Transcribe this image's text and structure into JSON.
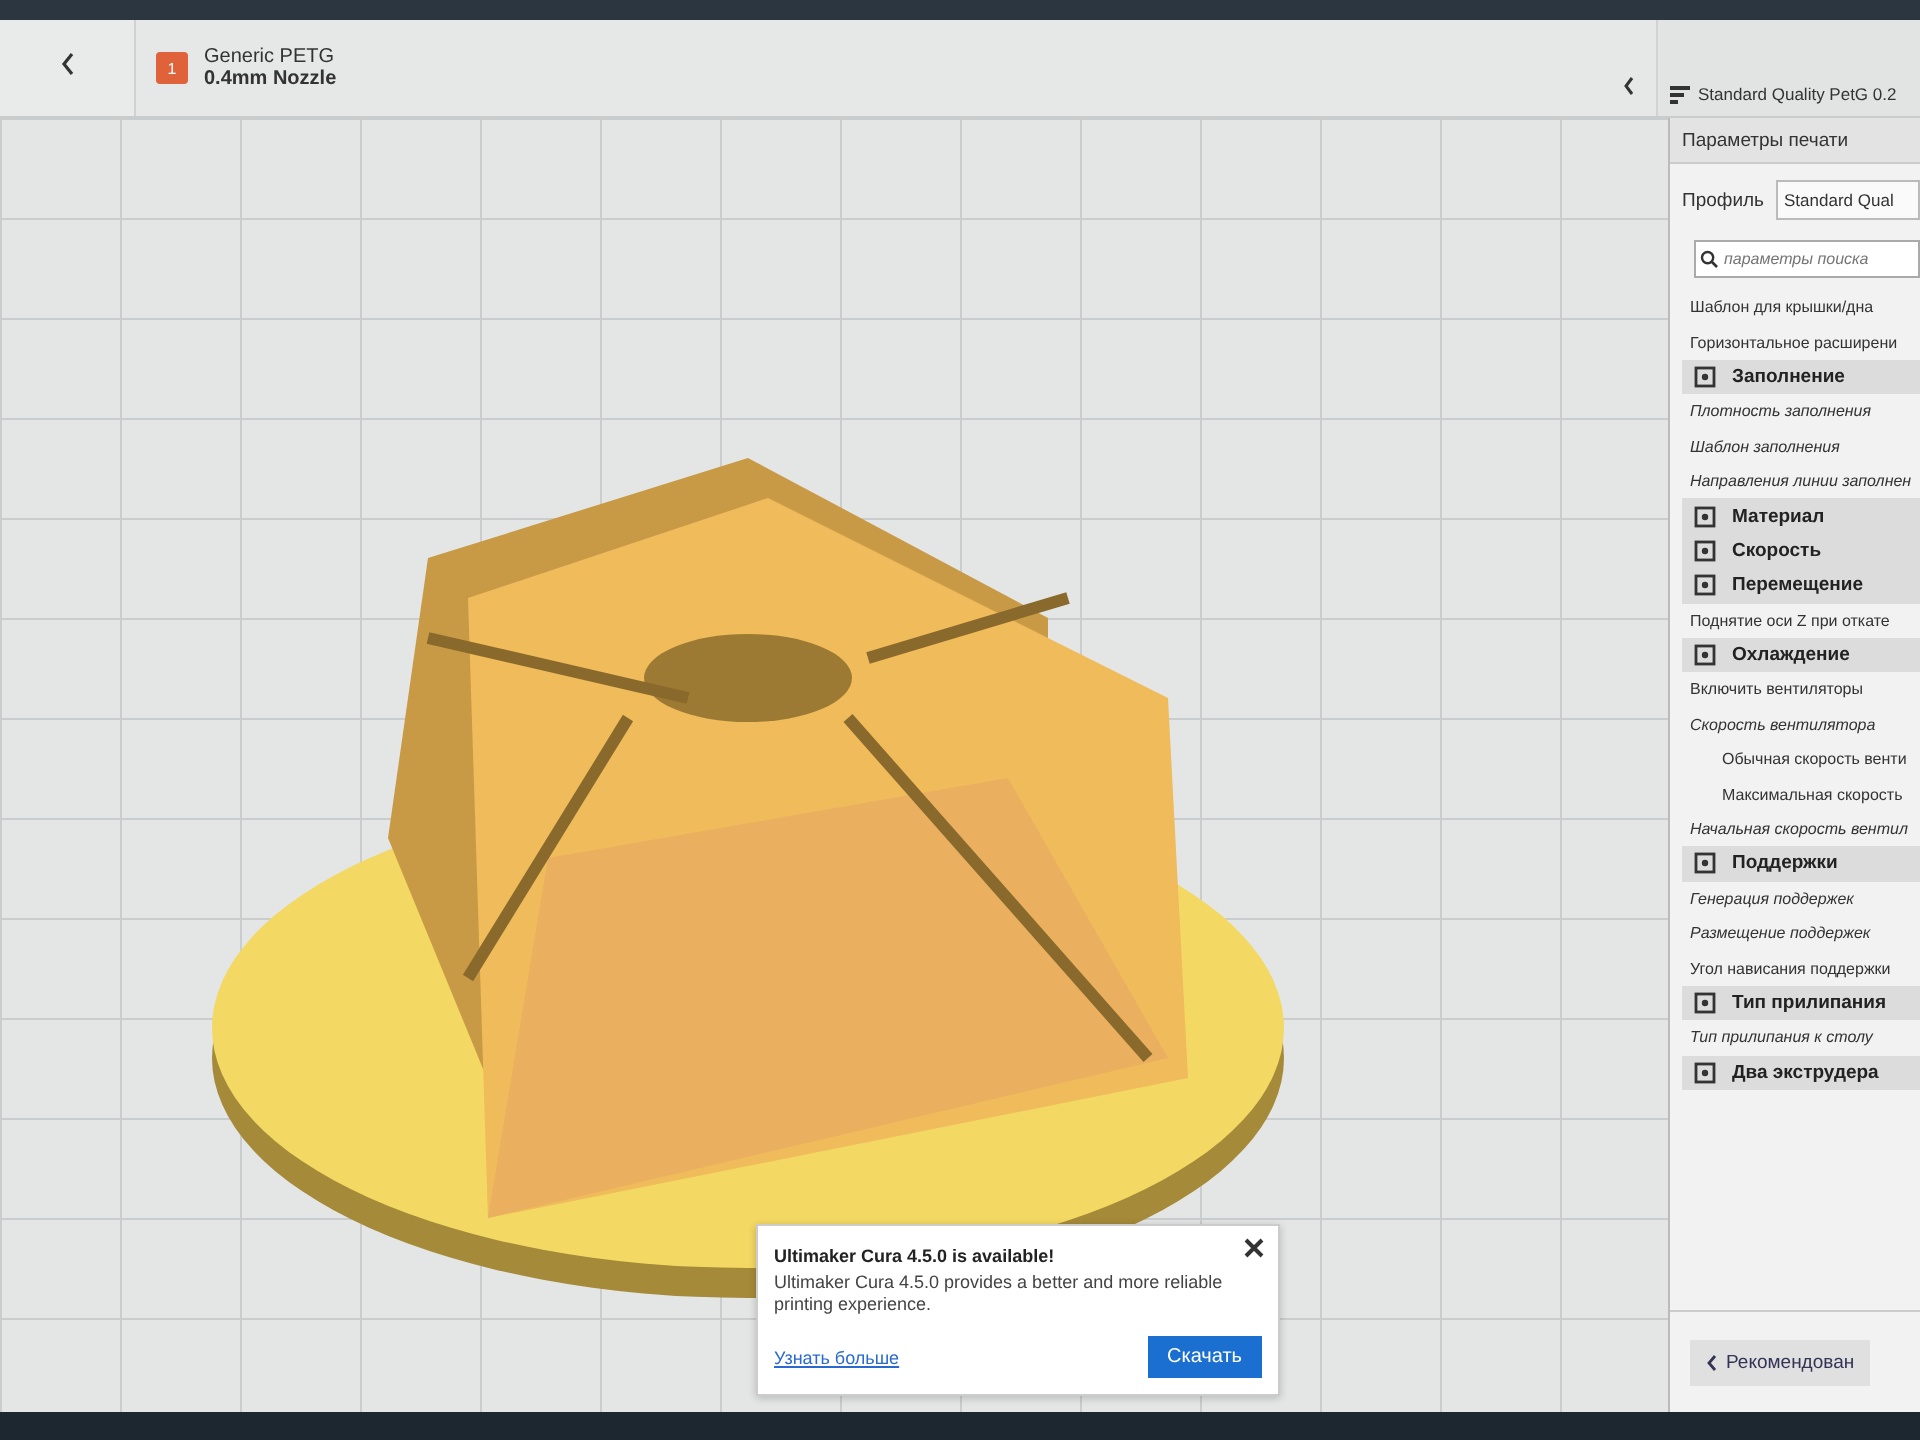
{
  "header": {
    "material": "Generic PETG",
    "nozzle": "0.4mm Nozzle",
    "extruder_number": "1",
    "quality": "Standard Quality PetG 0.2"
  },
  "settings_panel": {
    "title": "Параметры печати",
    "profile_label": "Профиль",
    "profile_value": "Standard Qual",
    "search_placeholder": "параметры поиска",
    "items": [
      {
        "kind": "setting",
        "label": "Шаблон для крышки/дна",
        "italic": false
      },
      {
        "kind": "setting",
        "label": "Горизонтальное расширени",
        "italic": false
      },
      {
        "kind": "category",
        "label": "Заполнение"
      },
      {
        "kind": "setting",
        "label": "Плотность заполнения",
        "italic": true
      },
      {
        "kind": "setting",
        "label": "Шаблон заполнения",
        "italic": true
      },
      {
        "kind": "setting",
        "label": "Направления линии заполнен",
        "italic": true
      },
      {
        "kind": "category",
        "label": "Материал"
      },
      {
        "kind": "category",
        "label": "Скорость"
      },
      {
        "kind": "category",
        "label": "Перемещение"
      },
      {
        "kind": "setting",
        "label": "Поднятие оси Z при откате",
        "italic": false
      },
      {
        "kind": "category",
        "label": "Охлаждение"
      },
      {
        "kind": "setting",
        "label": "Включить вентиляторы",
        "italic": false
      },
      {
        "kind": "setting",
        "label": "Скорость вентилятора",
        "italic": true,
        "children": [
          {
            "kind": "setting",
            "label": "Обычная скорость венти",
            "italic": false
          },
          {
            "kind": "setting",
            "label": "Максимальная скорость",
            "italic": false
          }
        ]
      },
      {
        "kind": "setting",
        "label": "Начальная скорость вентил",
        "italic": true
      },
      {
        "kind": "category",
        "label": "Поддержки"
      },
      {
        "kind": "setting",
        "label": "Генерация поддержек",
        "italic": true
      },
      {
        "kind": "setting",
        "label": "Размещение поддержек",
        "italic": true
      },
      {
        "kind": "setting",
        "label": "Угол нависания поддержки",
        "italic": false
      },
      {
        "kind": "category",
        "label": "Тип прилипания"
      },
      {
        "kind": "setting",
        "label": "Тип прилипания к столу",
        "italic": true
      },
      {
        "kind": "category",
        "label": "Два экструдера"
      }
    ],
    "recommended_button": "Рекомендован"
  },
  "notification": {
    "title": "Ultimaker Cura 4.5.0 is available!",
    "body": "Ultimaker Cura 4.5.0 provides a better and more reliable printing experience.",
    "link": "Узнать больше",
    "button": "Скачать"
  }
}
